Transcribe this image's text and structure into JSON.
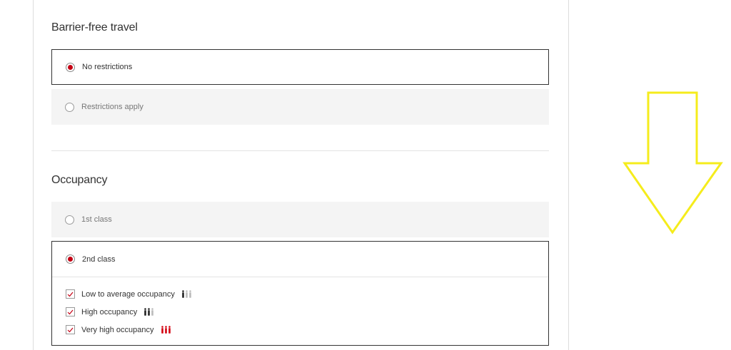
{
  "barrier_free": {
    "title": "Barrier-free travel",
    "options": [
      {
        "label": "No restrictions",
        "selected": true
      },
      {
        "label": "Restrictions apply",
        "selected": false
      }
    ]
  },
  "occupancy": {
    "title": "Occupancy",
    "options": [
      {
        "label": "1st class",
        "selected": false
      },
      {
        "label": "2nd class",
        "selected": true
      }
    ],
    "levels": [
      {
        "label": "Low to average occupancy",
        "checked": true,
        "icon": "occupancy-low-icon"
      },
      {
        "label": "High occupancy",
        "checked": true,
        "icon": "occupancy-high-icon"
      },
      {
        "label": "Very high occupancy",
        "checked": true,
        "icon": "occupancy-very-high-icon"
      }
    ]
  },
  "colors": {
    "accent": "#c50014",
    "annotation_arrow": "#f5ec1c"
  },
  "annotation": {
    "icon": "down-arrow-icon"
  }
}
